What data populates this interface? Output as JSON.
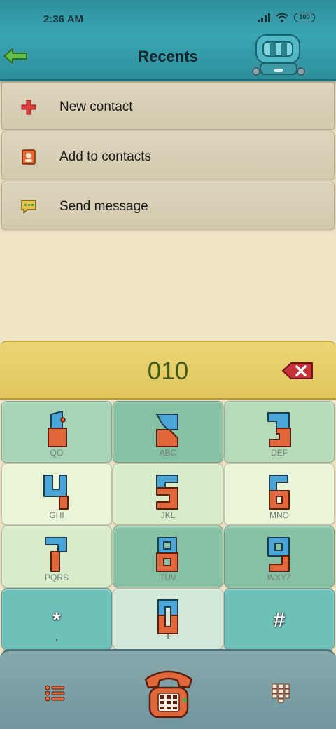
{
  "status": {
    "time": "2:36 AM",
    "battery": "100"
  },
  "header": {
    "title": "Recents"
  },
  "menu": {
    "items": [
      {
        "label": "New contact",
        "icon": "plus-icon"
      },
      {
        "label": "Add to contacts",
        "icon": "contact-card-icon"
      },
      {
        "label": "Send message",
        "icon": "message-bubble-icon"
      }
    ]
  },
  "dialer": {
    "number": "010"
  },
  "keypad": {
    "keys": [
      {
        "digit": "1",
        "letters": "QO"
      },
      {
        "digit": "2",
        "letters": "ABC"
      },
      {
        "digit": "3",
        "letters": "DEF"
      },
      {
        "digit": "4",
        "letters": "GHI"
      },
      {
        "digit": "5",
        "letters": "JKL"
      },
      {
        "digit": "6",
        "letters": "MNO"
      },
      {
        "digit": "7",
        "letters": "PQRS"
      },
      {
        "digit": "8",
        "letters": "TUV"
      },
      {
        "digit": "9",
        "letters": "WXYZ"
      },
      {
        "digit": "*",
        "letters": ","
      },
      {
        "digit": "0",
        "letters": "+"
      },
      {
        "digit": "#",
        "letters": ""
      }
    ]
  },
  "colors": {
    "header": "#3aa6b3",
    "number_bar": "#e2c65c",
    "digit_blue": "#4aa6d6",
    "digit_orange": "#e0683a"
  }
}
